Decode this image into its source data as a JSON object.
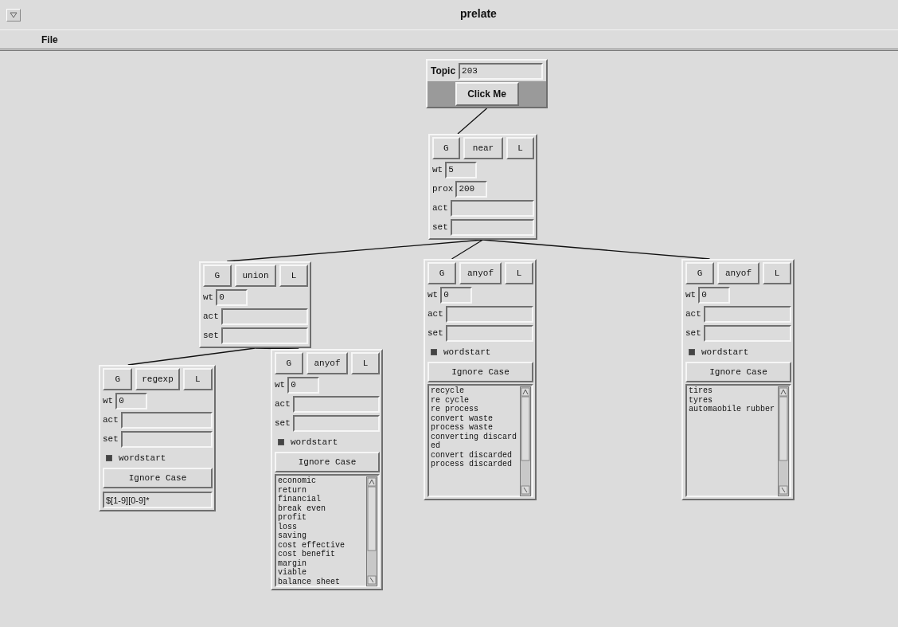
{
  "window": {
    "title": "prelate"
  },
  "menu": [
    "File"
  ],
  "topic": {
    "label": "Topic",
    "value": "203",
    "button": "Click Me",
    "root": {
      "buttons": [
        "G",
        "near",
        "L"
      ],
      "fields": [
        {
          "label": "wt",
          "value": "5",
          "kind": "number"
        },
        {
          "label": "prox",
          "value": "200",
          "kind": "number"
        },
        {
          "label": "act",
          "kind": "text"
        },
        {
          "label": "set",
          "kind": "text"
        }
      ],
      "children": [
        {
          "buttons": [
            "G",
            "union",
            "L"
          ],
          "fields": [
            {
              "label": "wt",
              "value": "0",
              "kind": "number"
            },
            {
              "label": "act",
              "kind": "text"
            },
            {
              "label": "set",
              "kind": "text"
            }
          ],
          "children": [
            {
              "buttons": [
                "G",
                "regexp",
                "L"
              ],
              "fields": [
                {
                  "label": "wt",
                  "value": "0",
                  "kind": "number"
                },
                {
                  "label": "act",
                  "kind": "text"
                },
                {
                  "label": "set",
                  "kind": "text"
                }
              ],
              "wordstart": {
                "label": "wordstart",
                "checked": true
              },
              "ignore_case": "Ignore Case",
              "pattern": "$[1-9][0-9]*"
            },
            {
              "buttons": [
                "G",
                "anyof",
                "L"
              ],
              "fields": [
                {
                  "label": "wt",
                  "value": "0",
                  "kind": "number"
                },
                {
                  "label": "act",
                  "kind": "text"
                },
                {
                  "label": "set",
                  "kind": "text"
                }
              ],
              "wordstart": {
                "label": "wordstart",
                "checked": true
              },
              "ignore_case": "Ignore Case",
              "terms": [
                "economic",
                "return",
                "financial",
                "break even",
                "profit",
                "loss",
                "saving",
                "cost effective",
                "cost benefit",
                "margin",
                "viable",
                "balance sheet"
              ]
            }
          ]
        },
        {
          "buttons": [
            "G",
            "anyof",
            "L"
          ],
          "fields": [
            {
              "label": "wt",
              "value": "0",
              "kind": "number"
            },
            {
              "label": "act",
              "kind": "text"
            },
            {
              "label": "set",
              "kind": "text"
            }
          ],
          "wordstart": {
            "label": "wordstart",
            "checked": true
          },
          "ignore_case": "Ignore Case",
          "terms": [
            "recycle",
            "re cycle",
            "re process",
            "convert waste",
            "process waste",
            "converting discarded",
            "convert discarded",
            "process discarded"
          ]
        },
        {
          "buttons": [
            "G",
            "anyof",
            "L"
          ],
          "fields": [
            {
              "label": "wt",
              "value": "0",
              "kind": "number"
            },
            {
              "label": "act",
              "kind": "text"
            },
            {
              "label": "set",
              "kind": "text"
            }
          ],
          "wordstart": {
            "label": "wordstart",
            "checked": true
          },
          "ignore_case": "Ignore Case",
          "terms": [
            "tires",
            "tyres",
            "automaobile rubber"
          ]
        }
      ]
    }
  }
}
